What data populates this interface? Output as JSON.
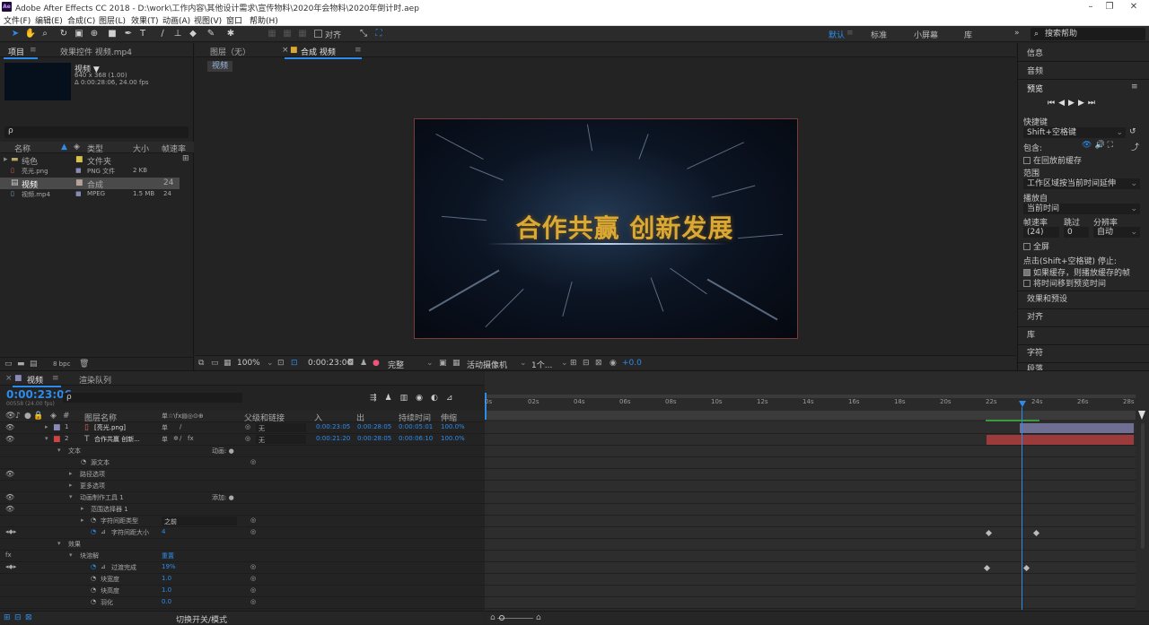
{
  "app": {
    "title": "Adobe After Effects CC 2018 - D:\\work\\工作内容\\其他设计需求\\宣传物料\\2020年会物料\\2020年倒计时.aep",
    "logo": "Ae"
  },
  "menu": [
    "文件(F)",
    "编辑(E)",
    "合成(C)",
    "图层(L)",
    "效果(T)",
    "动画(A)",
    "视图(V)",
    "窗口",
    "帮助(H)"
  ],
  "toolbar": {
    "snap_label": "对齐",
    "workspaces": [
      "默认",
      "标准",
      "小屏幕",
      "库"
    ],
    "search_placeholder": "搜索帮助"
  },
  "project": {
    "tab": "项目",
    "effect_tab": "效果控件 视频.mp4",
    "item_name": "视频 ▼",
    "item_dims": "640 x 368 (1.00)",
    "item_dur": "Δ 0:00:28:06, 24.00 fps",
    "search_icon": "ρ",
    "columns": [
      "名称",
      "类型",
      "大小",
      "帧速率"
    ],
    "rows": [
      {
        "name": "纯色",
        "type": "文件夹",
        "size": "",
        "fps": ""
      },
      {
        "name": "亮光.png",
        "type": "PNG 文件",
        "size": "2 KB",
        "fps": ""
      },
      {
        "name": "视频",
        "type": "合成",
        "size": "",
        "fps": "24"
      },
      {
        "name": "视频.mp4",
        "type": "MPEG",
        "size": "1.5 MB",
        "fps": "24"
      }
    ],
    "bpc": "8 bpc"
  },
  "viewer": {
    "layer_tab": "图层（无）",
    "comp_tab": "合成 视频",
    "comp_subtab": "视频",
    "comp_text": "合作共赢 创新发展",
    "zoom": "100%",
    "timecode": "0:00:23:06",
    "resolution": "完整",
    "camera": "活动摄像机",
    "views": "1个...",
    "exposure": "+0.0"
  },
  "right": {
    "info": "信息",
    "audio": "音频",
    "preview": "预览",
    "shortcut_label": "快捷键",
    "shortcut": "Shift+空格键",
    "include": "包含:",
    "cache_before": "在回放前缓存",
    "range_label": "范围",
    "range": "工作区域按当前时间延伸",
    "play_from_label": "播放自",
    "play_from": "当前时间",
    "fps_label": "帧速率",
    "skip_label": "跳过",
    "res_label": "分辨率",
    "fps": "(24)",
    "skip": "0",
    "res": "自动",
    "fullscreen": "全屏",
    "stop_label": "点击(Shift+空格键) 停止:",
    "stop_opt1": "如果缓存，则播放缓存的帧",
    "stop_opt2": "将时间移到预览时间",
    "sections": [
      "效果和预设",
      "对齐",
      "库",
      "字符",
      "段落"
    ]
  },
  "timeline": {
    "comp_tab": "视频",
    "render_tab": "渲染队列",
    "timecode": "0:00:23:06",
    "timecode_sub": "00558 (24.00 fps)",
    "col_headers": [
      "#",
      "图层名称",
      "单☆\\fx▤◎⊙⊕",
      "父级和链接",
      "入",
      "出",
      "持续时间",
      "伸缩"
    ],
    "ruler": [
      "0s",
      "02s",
      "04s",
      "06s",
      "08s",
      "10s",
      "12s",
      "14s",
      "16s",
      "18s",
      "20s",
      "22s",
      "24s",
      "26s",
      "28s"
    ],
    "layers": [
      {
        "num": "1",
        "name": "[亮光.png]",
        "parent": "无",
        "in": "0:00:23:05",
        "out": "0:00:28:05",
        "dur": "0:00:05:01",
        "stretch": "100.0%"
      },
      {
        "num": "2",
        "name": "合作共赢 创新...",
        "parent": "无",
        "in": "0:00:21:20",
        "out": "0:00:28:05",
        "dur": "0:00:06:10",
        "stretch": "100.0%"
      }
    ],
    "props": [
      {
        "indent": 3,
        "label": "文本",
        "extra": "动画: ●"
      },
      {
        "indent": 5,
        "label": "源文本",
        "extra": ""
      },
      {
        "indent": 4,
        "label": "路径选项",
        "extra": ""
      },
      {
        "indent": 4,
        "label": "更多选项",
        "extra": ""
      },
      {
        "indent": 4,
        "label": "动画制作工具 1",
        "extra": "添加: ●"
      },
      {
        "indent": 5,
        "label": "范围选择器 1",
        "extra": ""
      },
      {
        "indent": 5,
        "label": "字符间距类型",
        "extra": "之前"
      },
      {
        "indent": 5,
        "label": "字符间距大小",
        "extra": "4"
      },
      {
        "indent": 3,
        "label": "效果",
        "extra": ""
      },
      {
        "indent": 4,
        "label": "块溶解",
        "extra": "重置"
      },
      {
        "indent": 5,
        "label": "过渡完成",
        "extra": "19%"
      },
      {
        "indent": 5,
        "label": "块宽度",
        "extra": "1.0"
      },
      {
        "indent": 5,
        "label": "块高度",
        "extra": "1.0"
      },
      {
        "indent": 5,
        "label": "羽化",
        "extra": "0.0"
      }
    ],
    "bottom_label": "切换开关/模式"
  }
}
